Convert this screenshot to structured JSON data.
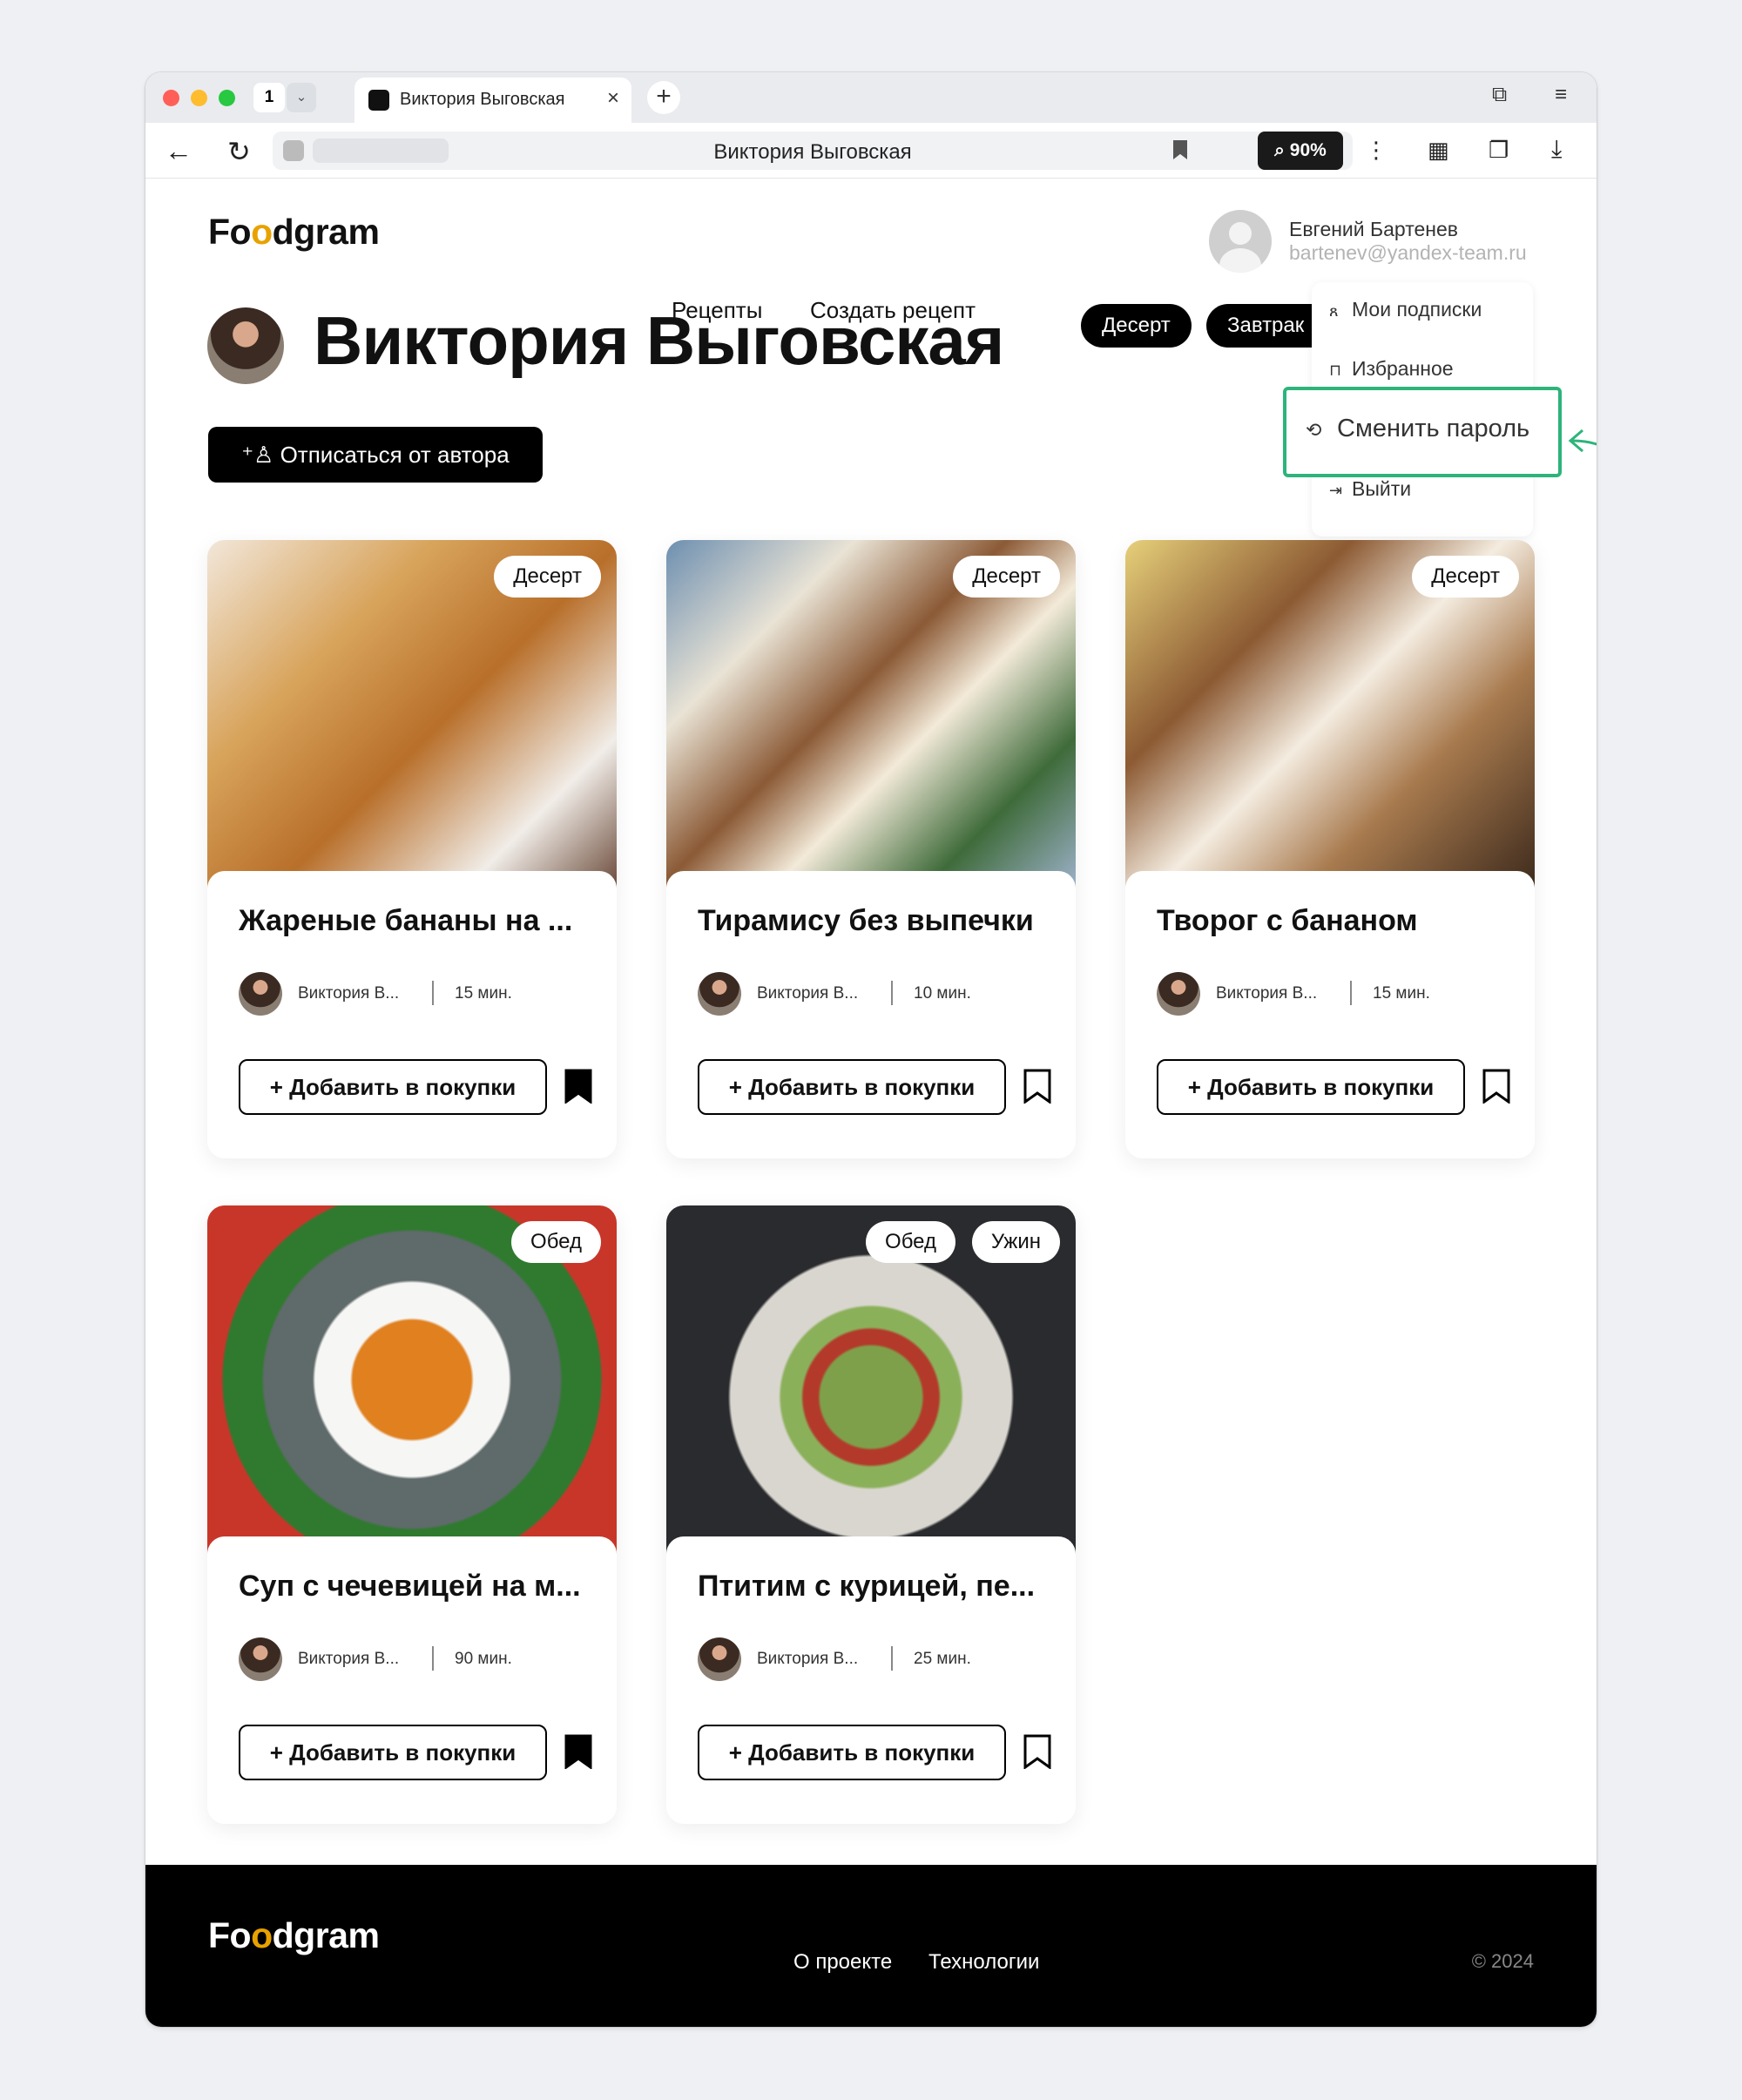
{
  "browser": {
    "tab_count": "1",
    "tab_title": "Виктория Выговская",
    "address_text": "Виктория Выговская",
    "zoom": "90%"
  },
  "site": {
    "logo": "Foodgram",
    "nav": [
      "Рецепты",
      "Создать рецепт"
    ],
    "user": {
      "name": "Евгений Бартенев",
      "email": "bartenev@yandex-team.ru"
    }
  },
  "author": {
    "name": "Виктория Выговская",
    "tags": [
      "Десерт",
      "Завтрак"
    ],
    "unsubscribe_label": "Отписаться от автора"
  },
  "menu": {
    "items": [
      "Мои подписки",
      "Избранное",
      "Сменить пароль",
      "Выйти"
    ],
    "highlighted": "Сменить пароль",
    "highlight_color": "#2db47a"
  },
  "cards": [
    {
      "title": "Жареные бананы на ...",
      "author": "Виктория В...",
      "time": "15 мин.",
      "tags": [
        "Десерт"
      ],
      "button": "+ Добавить в покупки",
      "favorited": true
    },
    {
      "title": "Тирамису без выпечки",
      "author": "Виктория В...",
      "time": "10 мин.",
      "tags": [
        "Десерт"
      ],
      "button": "+ Добавить в покупки",
      "favorited": false
    },
    {
      "title": "Творог с бананом",
      "author": "Виктория В...",
      "time": "15 мин.",
      "tags": [
        "Десерт"
      ],
      "button": "+ Добавить в покупки",
      "favorited": false
    },
    {
      "title": "Суп с чечевицей на м...",
      "author": "Виктория В...",
      "time": "90 мин.",
      "tags": [
        "Обед"
      ],
      "button": "+ Добавить в покупки",
      "favorited": true
    },
    {
      "title": "Птитим с курицей, пе...",
      "author": "Виктория В...",
      "time": "25 мин.",
      "tags": [
        "Обед",
        "Ужин"
      ],
      "button": "+ Добавить в покупки",
      "favorited": false
    }
  ],
  "footer": {
    "logo": "Foodgram",
    "links": [
      "О проекте",
      "Технологии"
    ],
    "copyright": "© 2024"
  }
}
